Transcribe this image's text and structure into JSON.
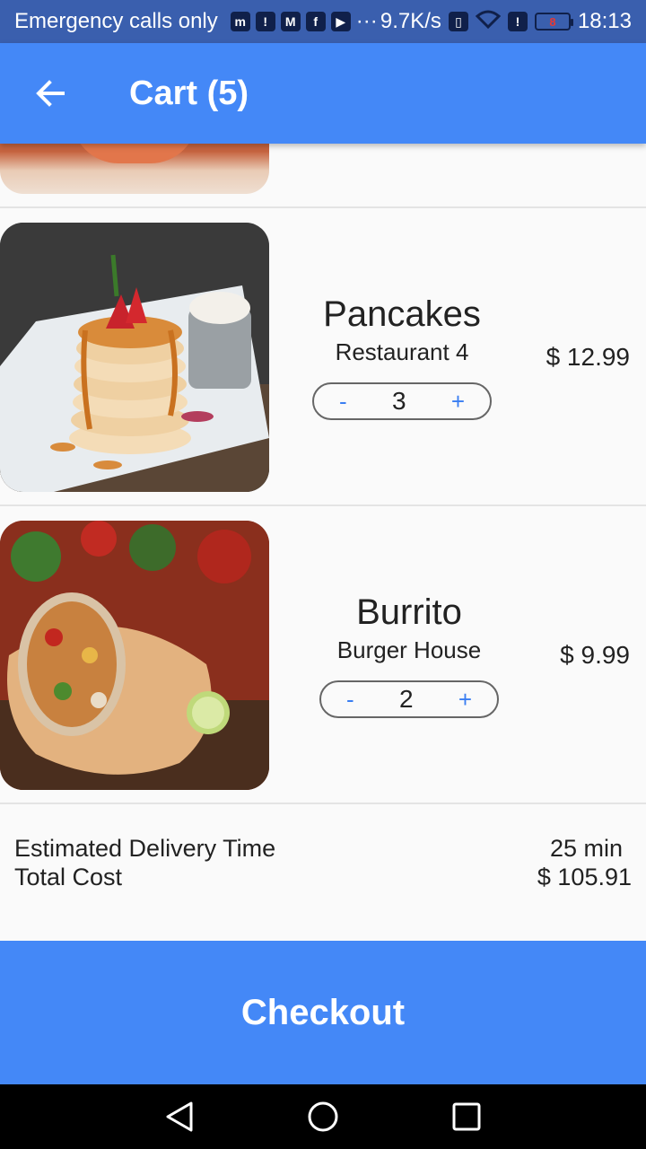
{
  "status_bar": {
    "carrier": "Emergency calls only",
    "speed": "9.7K/s",
    "more": "···",
    "battery_level": "8",
    "time": "18:13",
    "icons": [
      "messenger-icon",
      "sim-icon",
      "gmail-icon",
      "facebook-icon",
      "youtube-icon",
      "vibrate-icon",
      "wifi-icon",
      "alert-icon",
      "battery-icon"
    ]
  },
  "app_bar": {
    "title": "Cart (5)",
    "back_icon": "arrow-left-icon"
  },
  "cart": {
    "items": [
      {
        "name": "Pancakes",
        "restaurant": "Restaurant 4",
        "quantity": "3",
        "price": "$ 12.99",
        "minus": "-",
        "plus": "+"
      },
      {
        "name": "Burrito",
        "restaurant": "Burger House",
        "quantity": "2",
        "price": "$ 9.99",
        "minus": "-",
        "plus": "+"
      }
    ]
  },
  "summary": {
    "delivery_label": "Estimated Delivery Time",
    "delivery_value": "25 min",
    "total_label": "Total Cost",
    "total_value": "$ 105.91"
  },
  "checkout": {
    "label": "Checkout"
  },
  "colors": {
    "primary": "#4488f7",
    "status_bar": "#3a5fae",
    "accent": "#3a7ef2"
  }
}
